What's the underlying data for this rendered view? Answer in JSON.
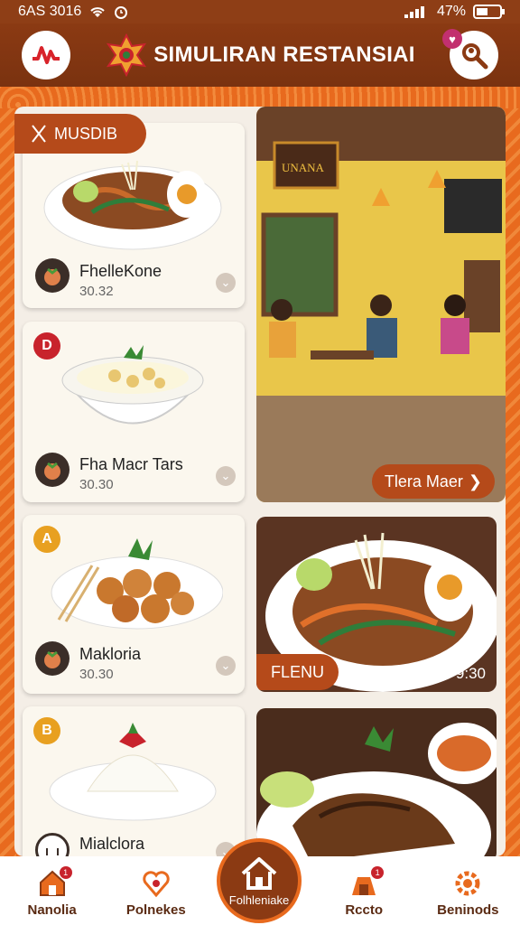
{
  "status_bar": {
    "time": "6AS 3016",
    "battery": "47%"
  },
  "header": {
    "title": "SIMULIRAN RESTANSIAI",
    "profile_badge": "♥"
  },
  "category_tag": {
    "label": "MUSDIB"
  },
  "menu_items": [
    {
      "name": "FhelleKone",
      "price": "30.32",
      "badge": ""
    },
    {
      "name": "Fha Macr Tars",
      "price": "30.30",
      "badge": "D"
    },
    {
      "name": "Makloria",
      "price": "30.30",
      "badge": "A"
    },
    {
      "name": "Mialclora",
      "price": "",
      "badge": "B"
    }
  ],
  "restaurant_photo": {
    "sign_text": "UNANA",
    "cta_label": "Tlera Maer"
  },
  "promo_dish": {
    "label": "FLENU",
    "price": "9:30"
  },
  "bottom_nav": {
    "items": [
      {
        "label": "Nanolia"
      },
      {
        "label": "Polnekes"
      },
      {
        "label": "Rccto"
      },
      {
        "label": "Beninods"
      }
    ],
    "home_label": "Folhleniake"
  },
  "colors": {
    "accent": "#e86a1e",
    "brand_brown": "#8b3a13",
    "cta": "#b54a1a"
  }
}
